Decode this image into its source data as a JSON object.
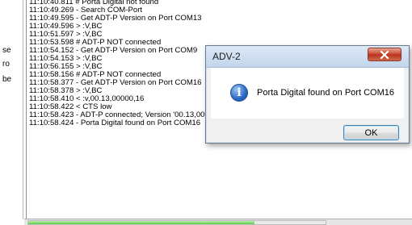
{
  "left_fragments": [
    "se",
    "ro",
    "be"
  ],
  "log": {
    "lines": [
      "11:10:40.811 # Porta Digital not found",
      "11:10:49.269 - Search COM-Port",
      "11:10:49.595 - Get ADT-P Version on Port COM13",
      "11:10:49.596 > :V,BC",
      "11:10:51.597 > :V,BC",
      "11:10:53.598 # ADT-P NOT connected",
      "11:10:54.152 - Get ADT-P Version on Port COM9",
      "11:10:54.153 > :V,BC",
      "11:10:56.155 > :V,BC",
      "11:10:58.156 # ADT-P NOT connected",
      "11:10:58.377 - Get ADT-P Version on Port COM16",
      "11:10:58.378 > :V,BC",
      "11:10:58.410 < :v,00.13,00000,16",
      "11:10:58.422 < CTS low",
      "11:10:58.423 - ADT-P connected; Version '00.13,00000,'",
      "11:10:58.424 - Porta Digital found on Port COM16"
    ]
  },
  "progress": {
    "value_fraction": 0.76
  },
  "dialog": {
    "title": "ADV-2",
    "message": "Porta Digital found on Port COM16",
    "ok_label": "OK",
    "close_glyph": "✕",
    "icon": "info-icon",
    "info_glyph": "i"
  },
  "colors": {
    "close_button": "#c8432b",
    "info_icon": "#2a68c7",
    "progress": "#5fcf4c"
  }
}
